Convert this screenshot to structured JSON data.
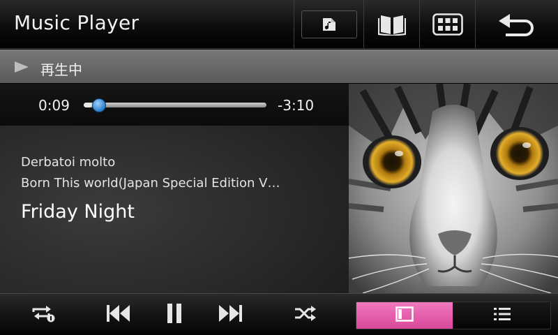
{
  "header": {
    "title": "Music Player",
    "buttons": [
      {
        "name": "music-folder",
        "icon": "music-folder-icon"
      },
      {
        "name": "book",
        "icon": "book-icon"
      },
      {
        "name": "grid",
        "icon": "grid-icon"
      },
      {
        "name": "back",
        "icon": "back-arrow-icon"
      }
    ]
  },
  "status": {
    "icon": "play-icon",
    "text": "再生中"
  },
  "playback": {
    "elapsed": "0:09",
    "remaining": "-3:10",
    "progress_fraction": 0.045
  },
  "track": {
    "artist": "Derbatoi molto",
    "album": "Born This world(Japan Special Edition V…",
    "title": "Friday Night"
  },
  "album_art": {
    "icon": "cat-album-art",
    "subject": "cat"
  },
  "controls": {
    "repeat_icon": "repeat-one-icon",
    "prev_icon": "skip-previous-icon",
    "pause_icon": "pause-icon",
    "next_icon": "skip-next-icon",
    "shuffle_icon": "shuffle-icon",
    "view_now_icon": "now-playing-view-icon",
    "view_list_icon": "list-view-icon"
  },
  "colors": {
    "accent_pink": "#e35aa8",
    "progress_thumb": "#3a8fd8",
    "header_bg": "#0d0d0d",
    "status_bg": "#6a6a6a"
  }
}
